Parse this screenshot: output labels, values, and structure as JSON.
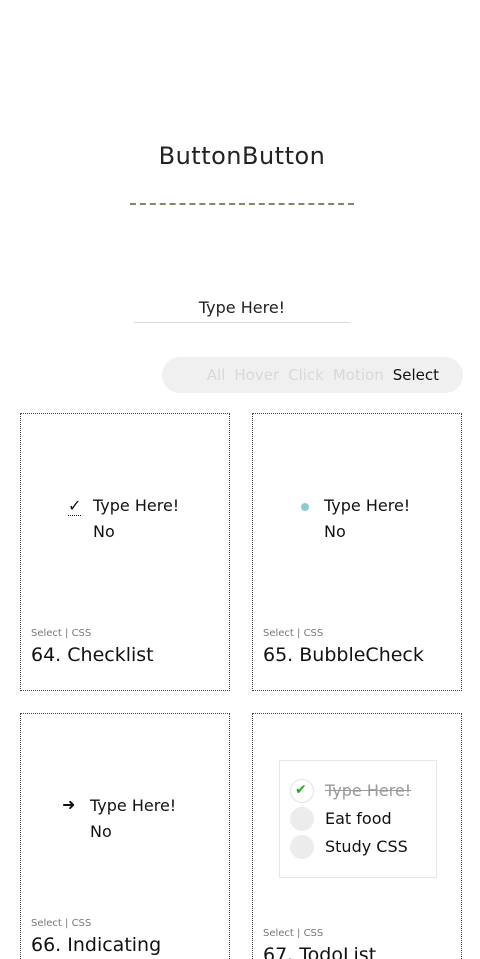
{
  "header": {
    "title": "ButtonButton",
    "input_placeholder": "Type Here!"
  },
  "filters": {
    "all": "All",
    "hover": "Hover",
    "click": "Click",
    "motion": "Motion",
    "select": "Select",
    "active": "Select"
  },
  "cards": [
    {
      "meta": "Select | CSS",
      "title": "64. Checklist",
      "options": [
        "Type Here!",
        "No"
      ],
      "icon": "checkmark-icon"
    },
    {
      "meta": "Select | CSS",
      "title": "65. BubbleCheck",
      "options": [
        "Type Here!",
        "No"
      ],
      "icon": "bubble-dot-icon",
      "accent": "#8dcbd4"
    },
    {
      "meta": "Select | CSS",
      "title": "66. Indicating",
      "options": [
        "Type Here!",
        "No"
      ],
      "icon": "arrow-right-icon"
    },
    {
      "meta": "Select | CSS",
      "title": "67. TodoList",
      "todos": [
        {
          "text": "Type Here!",
          "done": true
        },
        {
          "text": "Eat food",
          "done": false
        },
        {
          "text": "Study CSS",
          "done": false
        }
      ],
      "check_color": "#2aa52a"
    }
  ]
}
